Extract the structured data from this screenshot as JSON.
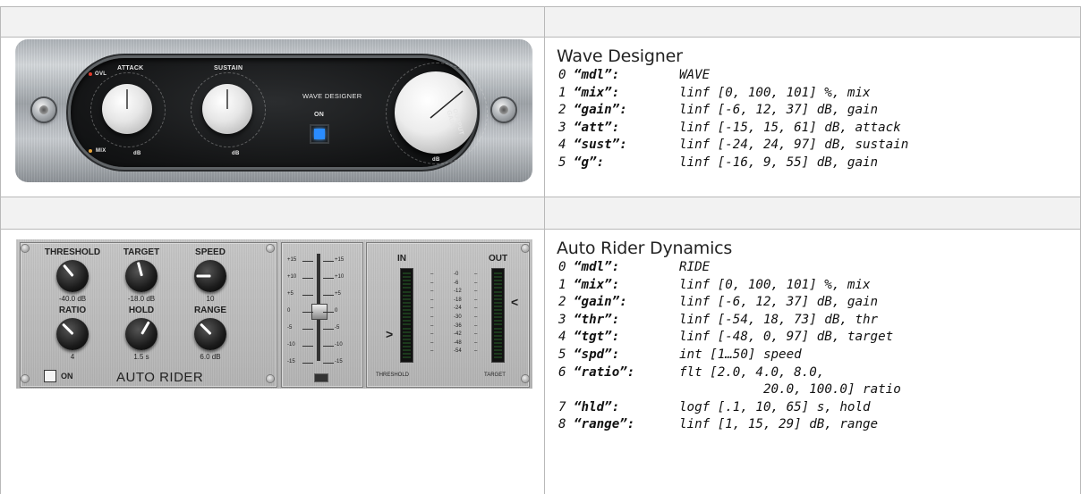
{
  "wave_designer": {
    "title": "Wave Designer",
    "panel": {
      "brand": "WAVE DESIGNER",
      "attack_label": "ATTACK",
      "sustain_label": "SUSTAIN",
      "on_label": "ON",
      "output_gain_label": "OUTPUT GAIN",
      "ovl_label": "OVL",
      "mix_label": "MIX",
      "db_label": "dB",
      "on_button_color": "#2a8cff"
    },
    "params": [
      {
        "index": "0",
        "key": "“mdl”:",
        "spec": "WAVE"
      },
      {
        "index": "1",
        "key": "“mix”:",
        "spec": "linf [0, 100, 101] %, mix"
      },
      {
        "index": "2",
        "key": "“gain”:",
        "spec": "linf [-6, 12, 37] dB, gain"
      },
      {
        "index": "3",
        "key": "“att”:",
        "spec": "linf [-15, 15, 61] dB, attack"
      },
      {
        "index": "4",
        "key": "“sust”:",
        "spec": "linf [-24, 24, 97] dB, sustain"
      },
      {
        "index": "5",
        "key": "“g”:",
        "spec": "linf [-16, 9, 55] dB, gain"
      }
    ]
  },
  "auto_rider": {
    "title": "Auto Rider Dynamics",
    "panel": {
      "name": "AUTO RIDER",
      "on_label": "ON",
      "knobs": [
        {
          "label": "THRESHOLD",
          "value": "-40.0 dB"
        },
        {
          "label": "TARGET",
          "value": "-18.0 dB"
        },
        {
          "label": "SPEED",
          "value": "10"
        },
        {
          "label": "RATIO",
          "value": "4"
        },
        {
          "label": "HOLD",
          "value": "1.5 s"
        },
        {
          "label": "RANGE",
          "value": "6.0 dB"
        }
      ],
      "fader_ticks": [
        "+15",
        "+10",
        "+5",
        "0",
        "-5",
        "-10",
        "-15"
      ],
      "meter_in": "IN",
      "meter_out": "OUT",
      "meter_threshold": "THRESHOLD",
      "meter_target": "TARGET",
      "meter_scale": [
        "-0",
        "-6",
        "-12",
        "-18",
        "-24",
        "-30",
        "-36",
        "-42",
        "-48",
        "-54"
      ],
      "arrow_left": ">",
      "arrow_right": "<"
    },
    "params": [
      {
        "index": "0",
        "key": "“mdl”:",
        "spec": "RIDE"
      },
      {
        "index": "1",
        "key": "“mix”:",
        "spec": "linf [0, 100, 101] %, mix"
      },
      {
        "index": "2",
        "key": "“gain”:",
        "spec": "linf [-6, 12, 37] dB, gain"
      },
      {
        "index": "3",
        "key": "“thr”:",
        "spec": "linf [-54, 18, 73] dB, thr"
      },
      {
        "index": "4",
        "key": "“tgt”:",
        "spec": "linf [-48, 0, 97] dB, target"
      },
      {
        "index": "5",
        "key": "“spd”:",
        "spec": "int [1…50] speed"
      },
      {
        "index": "6",
        "key": "“ratio”:",
        "spec": "flt [2.0, 4.0, 8.0,"
      },
      {
        "index": "",
        "key": "",
        "spec": "20.0, 100.0] ratio"
      },
      {
        "index": "7",
        "key": "“hld”:",
        "spec": "logf [.1, 10, 65] s, hold"
      },
      {
        "index": "8",
        "key": "“range”:",
        "spec": "linf [1, 15, 29] dB, range"
      }
    ]
  }
}
